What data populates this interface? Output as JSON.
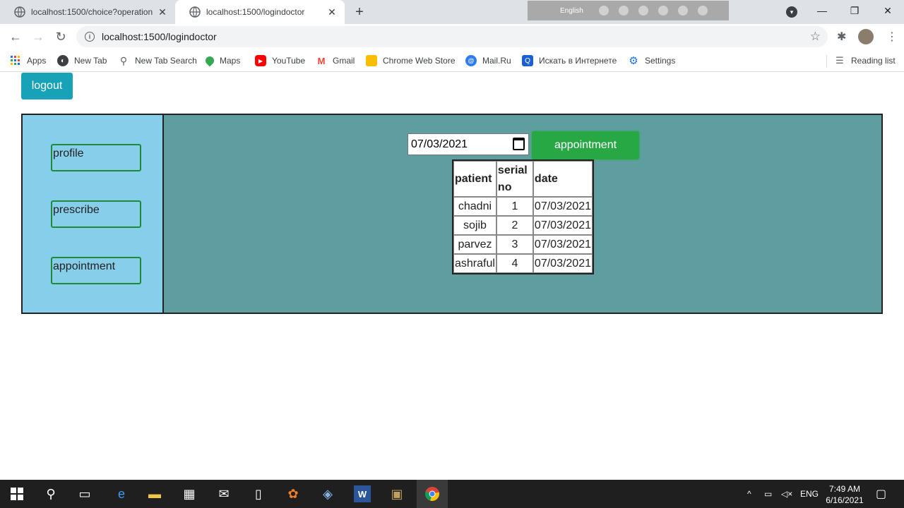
{
  "browser": {
    "tabs": [
      {
        "title": "localhost:1500/choice?operation",
        "active": false
      },
      {
        "title": "localhost:1500/logindoctor",
        "active": true
      }
    ],
    "language_bar": {
      "label": "English"
    },
    "url": "localhost:1500/logindoctor",
    "bookmarks": [
      {
        "label": "Apps",
        "icon": "apps-grid-icon",
        "color": "#1a73e8"
      },
      {
        "label": "New Tab",
        "icon": "globe-icon",
        "color": "#3c4043"
      },
      {
        "label": "New Tab Search",
        "icon": "search-icon",
        "color": "#5f6368"
      },
      {
        "label": "Maps",
        "icon": "maps-pin-icon",
        "color": "#34a853"
      },
      {
        "label": "YouTube",
        "icon": "youtube-icon",
        "color": "#ff0000"
      },
      {
        "label": "Gmail",
        "icon": "gmail-icon",
        "color": "#ea4335"
      },
      {
        "label": "Chrome Web Store",
        "icon": "web-store-icon",
        "color": "#fbbc04"
      },
      {
        "label": "Mail.Ru",
        "icon": "mailru-icon",
        "color": "#2d7cf6"
      },
      {
        "label": "Искать в Интернете",
        "icon": "search-web-icon",
        "color": "#1a5fd6"
      },
      {
        "label": "Settings",
        "icon": "gear-icon",
        "color": "#1a73e8"
      }
    ],
    "reading_list": "Reading list"
  },
  "page": {
    "logout_label": "logout",
    "sidebar": [
      {
        "label": "profile"
      },
      {
        "label": "prescribe"
      },
      {
        "label": "appointment"
      }
    ],
    "date_value": "07/03/2021",
    "appointment_button": "appointment",
    "table": {
      "headers": [
        "patient",
        "serial no",
        "date"
      ],
      "rows": [
        [
          "chadni",
          "1",
          "07/03/2021"
        ],
        [
          "sojib",
          "2",
          "07/03/2021"
        ],
        [
          "parvez",
          "3",
          "07/03/2021"
        ],
        [
          "ashraful",
          "4",
          "07/03/2021"
        ]
      ]
    }
  },
  "taskbar": {
    "lang": "ENG",
    "time": "7:49 AM",
    "date": "6/16/2021"
  },
  "colors": {
    "sidebar_bg": "#87ceeb",
    "main_bg": "#5f9ea0",
    "logout_bg": "#17a2b8",
    "appointment_bg": "#28a745",
    "sidebar_button_border": "#1e8a3a"
  }
}
